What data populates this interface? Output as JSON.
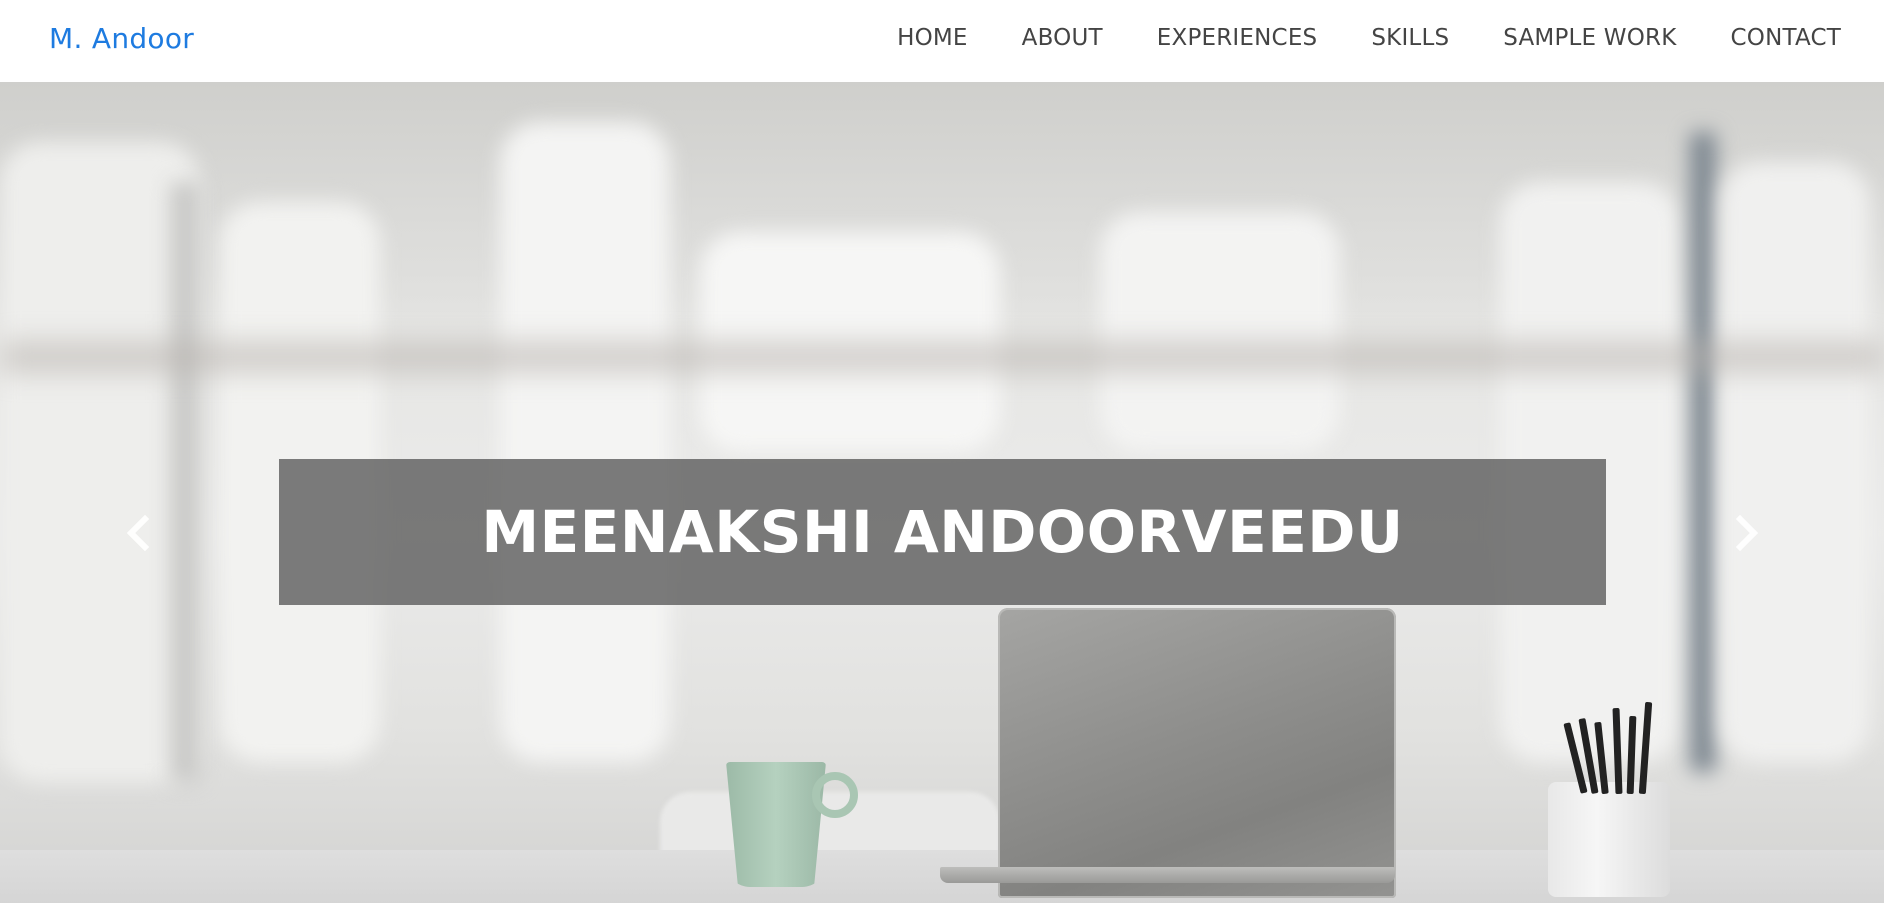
{
  "navbar": {
    "brand": "M. Andoor",
    "items": [
      {
        "label": "HOME"
      },
      {
        "label": "ABOUT"
      },
      {
        "label": "EXPERIENCES"
      },
      {
        "label": "SKILLS"
      },
      {
        "label": "SAMPLE WORK"
      },
      {
        "label": "CONTACT"
      }
    ]
  },
  "hero": {
    "title": "MEENAKSHI ANDOORVEEDU",
    "prev_icon": "chevron-left-icon",
    "next_icon": "chevron-right-icon"
  },
  "colors": {
    "brand": "#1e7be0",
    "nav_text": "#444444",
    "title_band": "#5f5f5f",
    "title_text": "#ffffff"
  }
}
